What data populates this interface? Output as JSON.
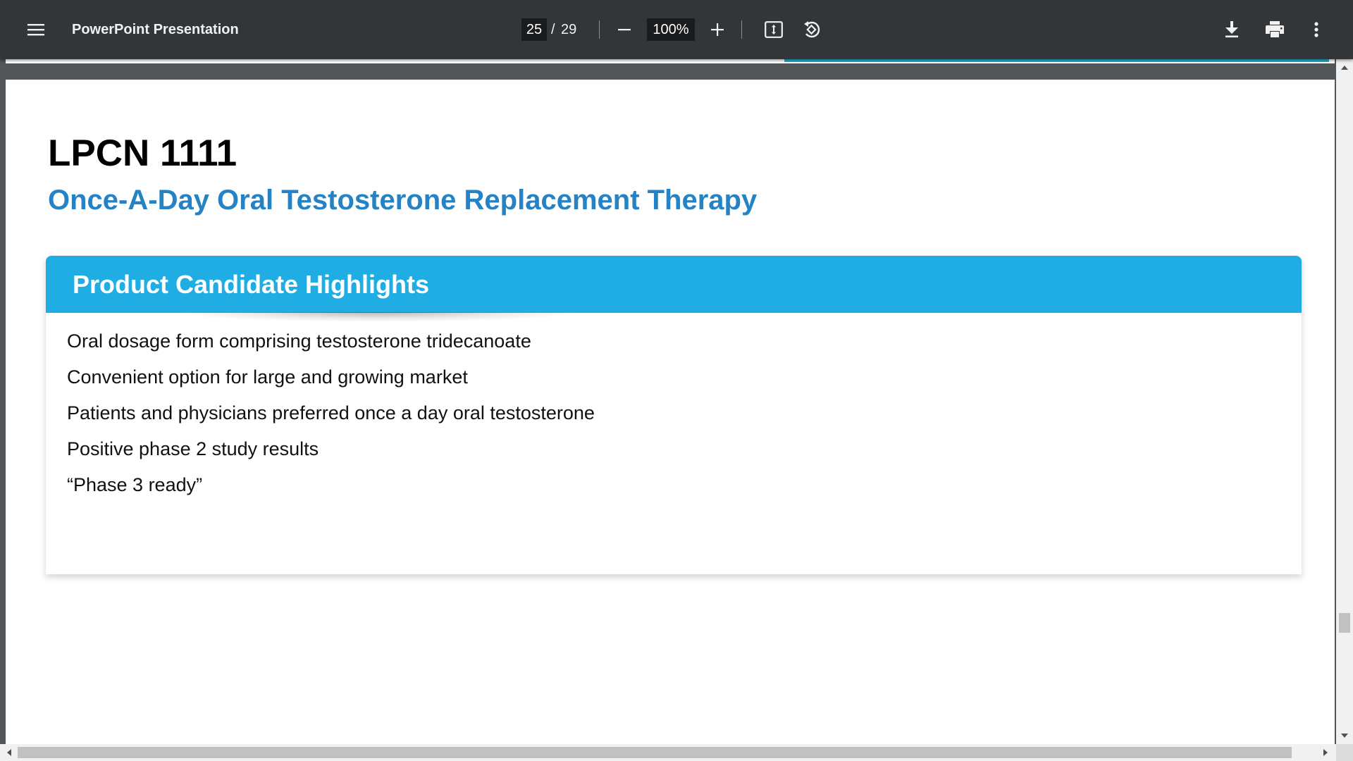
{
  "toolbar": {
    "menu_icon": "hamburger-menu-icon",
    "title": "PowerPoint Presentation",
    "page_current": "25",
    "page_separator": "/",
    "page_total": "29",
    "zoom_out_icon": "minus-icon",
    "zoom_value": "100%",
    "zoom_in_icon": "plus-icon",
    "fit_icon": "fit-to-page-icon",
    "rotate_icon": "rotate-counterclockwise-icon",
    "download_icon": "download-icon",
    "print_icon": "print-icon",
    "more_icon": "more-vertical-icon",
    "colors": {
      "toolbar_bg": "#323639",
      "input_bg": "#191b1c",
      "text": "#f1f1f1"
    }
  },
  "slide": {
    "title": "LPCN 1111",
    "subtitle": "Once-A-Day Oral Testosterone Replacement Therapy",
    "card": {
      "header": "Product Candidate Highlights",
      "bullets": [
        "Oral dosage form comprising testosterone tridecanoate",
        "Convenient option for large and growing market",
        "Patients and physicians preferred once a day oral testosterone",
        "Positive phase 2 study results",
        "“Phase 3 ready”"
      ]
    },
    "colors": {
      "subtitle": "#2582c4",
      "card_header_bg": "#20ade3",
      "previous_page_accent": "#1eb0cf"
    }
  },
  "viewer": {
    "background": "#525659"
  }
}
